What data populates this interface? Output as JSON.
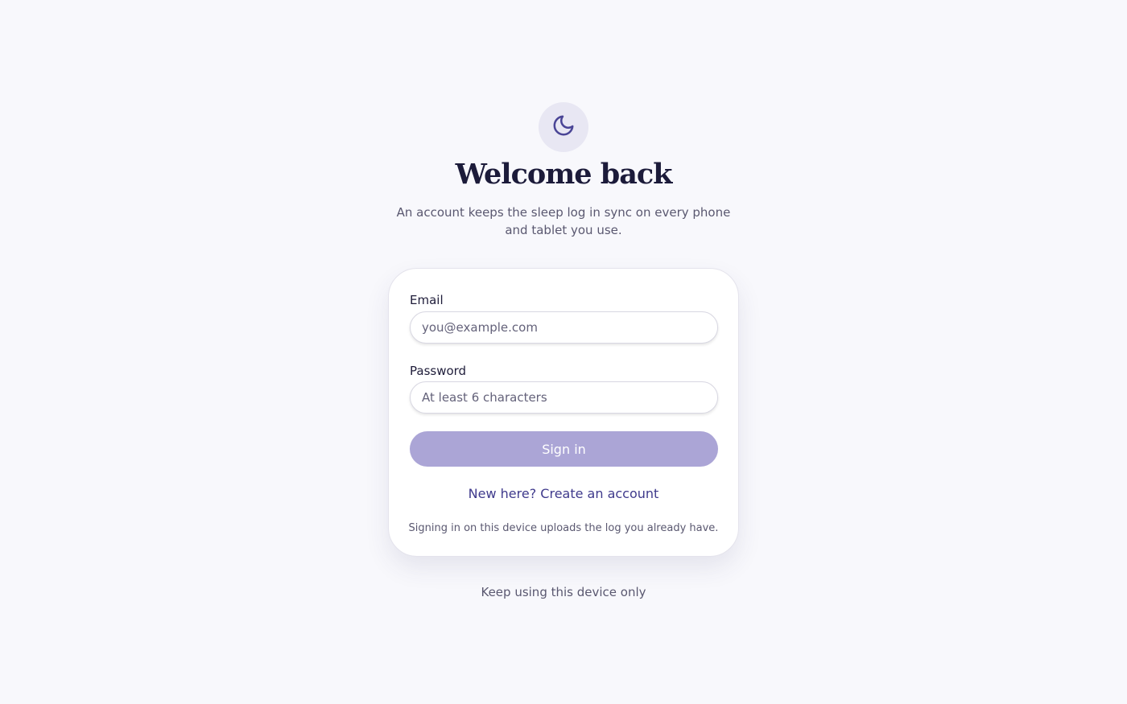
{
  "header": {
    "logo_icon": "moon-icon",
    "title": "Welcome back",
    "subtitle": "An account keeps the sleep log in sync on every phone and tablet you use."
  },
  "form": {
    "email_label": "Email",
    "email_value": "",
    "email_placeholder": "you@example.com",
    "password_label": "Password",
    "password_value": "",
    "password_placeholder": "At least 6 characters",
    "signin_label": "Sign in",
    "create_account_label": "New here? Create an account",
    "note": "Signing in on this device uploads the log you already have."
  },
  "footer": {
    "local_only_label": "Keep using this device only"
  },
  "colors": {
    "background": "#f8f8fc",
    "accent": "#3f3a8c",
    "button": "#aba5d6",
    "logo_bg": "#e8e7f3"
  }
}
